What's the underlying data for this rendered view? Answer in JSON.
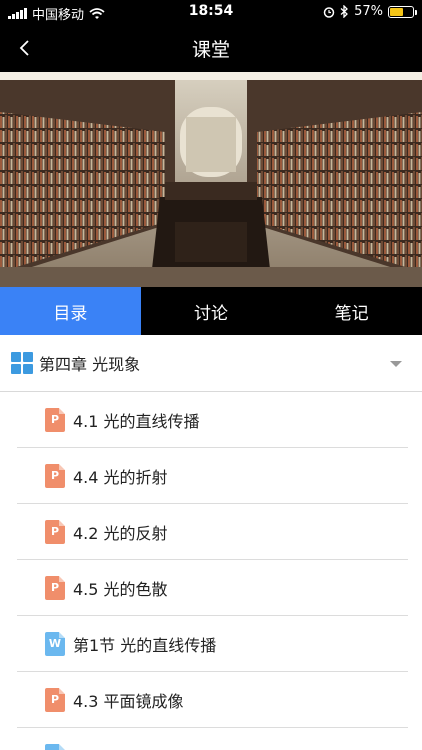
{
  "status_bar": {
    "carrier": "中国移动",
    "time": "18:54",
    "battery": "57%",
    "battery_level": 0.57
  },
  "nav": {
    "title": "课堂"
  },
  "tabs": [
    {
      "label": "目录",
      "active": true
    },
    {
      "label": "讨论",
      "active": false
    },
    {
      "label": "笔记",
      "active": false
    }
  ],
  "chapter": {
    "title": "第四章  光现象"
  },
  "items": [
    {
      "type": "ppt",
      "badge": "P",
      "label": "4.1  光的直线传播"
    },
    {
      "type": "ppt",
      "badge": "P",
      "label": "4.4  光的折射"
    },
    {
      "type": "ppt",
      "badge": "P",
      "label": "4.2  光的反射"
    },
    {
      "type": "ppt",
      "badge": "P",
      "label": "4.5  光的色散"
    },
    {
      "type": "doc",
      "badge": "W",
      "label": "第1节  光的直线传播"
    },
    {
      "type": "ppt",
      "badge": "P",
      "label": "4.3  平面镜成像"
    },
    {
      "type": "doc",
      "badge": "W",
      "label": ""
    }
  ],
  "colors": {
    "accent": "#3a82f6",
    "ppt": "#f08e6b",
    "doc": "#6bb8ef",
    "chapter_icon": "#3c9ae0"
  }
}
